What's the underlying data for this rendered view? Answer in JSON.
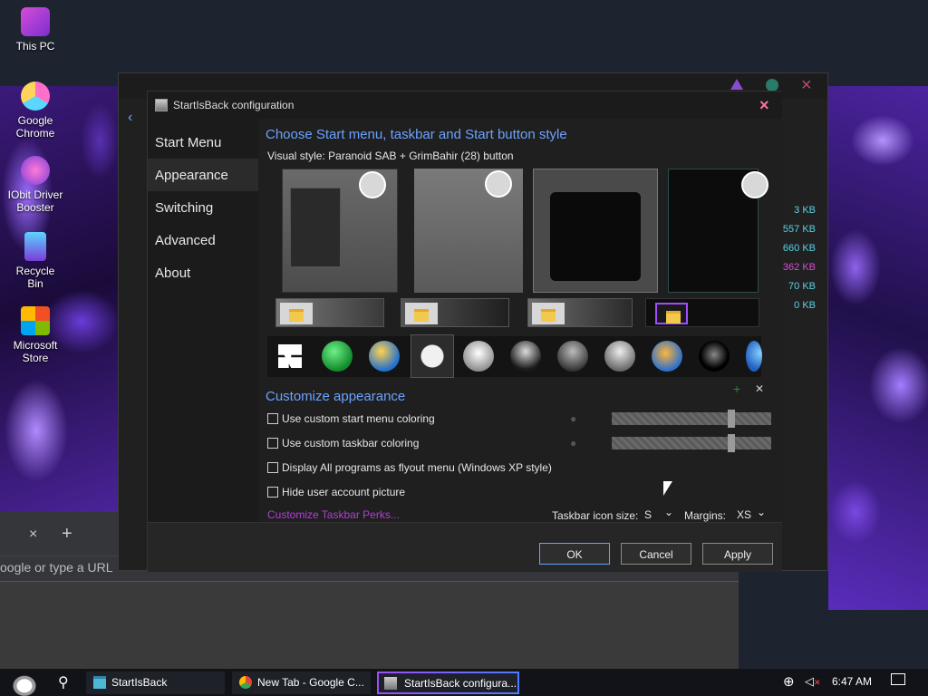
{
  "desktop": {
    "icons": [
      {
        "label": "This PC",
        "icon": "this-pc-icon"
      },
      {
        "label": "Google Chrome",
        "icon": "chrome-icon"
      },
      {
        "label": "IObit Driver Booster",
        "icon": "driver-booster-icon"
      },
      {
        "label": "Recycle Bin",
        "icon": "recycle-bin-icon"
      },
      {
        "label": "Microsoft Store",
        "icon": "store-icon"
      }
    ]
  },
  "background_window": {
    "sizes": [
      {
        "text": "3 KB",
        "color": "#59d1e6"
      },
      {
        "text": "557 KB",
        "color": "#59d1e6"
      },
      {
        "text": "660 KB",
        "color": "#59d1e6"
      },
      {
        "text": "362 KB",
        "color": "#d84cd8"
      },
      {
        "text": "70 KB",
        "color": "#59d1e6"
      },
      {
        "text": "0 KB",
        "color": "#59d1e6"
      }
    ]
  },
  "browser": {
    "tab_close": "×",
    "new_tab": "+",
    "url_placeholder": "oogle or type a URL"
  },
  "dialog": {
    "title": "StartIsBack configuration",
    "close": "×",
    "nav": [
      "Start Menu",
      "Appearance",
      "Switching",
      "Advanced",
      "About"
    ],
    "active_nav": "Appearance",
    "style_heading": "Choose Start menu, taskbar and Start button style",
    "visual_style_label": "Visual style:  Paranoid SAB + GrimBahir (28) button",
    "customize_heading": "Customize appearance",
    "plus": "+",
    "x": "✕",
    "options": [
      {
        "label": "Use custom start menu coloring",
        "checked": false
      },
      {
        "label": "Use custom taskbar coloring",
        "checked": false
      },
      {
        "label": "Display All programs as flyout menu (Windows XP style)",
        "checked": false
      },
      {
        "label": "Hide user account picture",
        "checked": false
      }
    ],
    "perks_link": "Customize Taskbar Perks...",
    "icon_size_label": "Taskbar icon size:",
    "icon_size_value": "S",
    "margins_label": "Margins:",
    "margins_value": "XS",
    "chevron": "⌄",
    "ok": "OK",
    "cancel": "Cancel",
    "apply": "Apply",
    "accent_color": "#6aa3ff",
    "link_color": "#b23fd6"
  },
  "taskbar": {
    "items": [
      {
        "label": "StartIsBack",
        "icon": "folder-icon"
      },
      {
        "label": "New Tab - Google C...",
        "icon": "chrome-icon"
      },
      {
        "label": "StartIsBack configura...",
        "icon": "config-icon",
        "active": true
      }
    ],
    "time": "6:47 AM",
    "search": "⚲"
  }
}
